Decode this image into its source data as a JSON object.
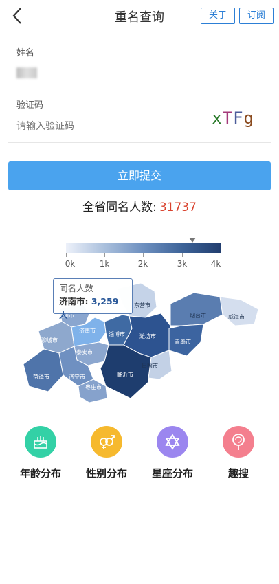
{
  "header": {
    "title": "重名查询",
    "about_label": "关于",
    "subscribe_label": "订阅"
  },
  "form": {
    "name_label": "姓名",
    "captcha_label": "验证码",
    "captcha_placeholder": "请输入验证码",
    "captcha_chars": [
      "x",
      "T",
      "F",
      "g"
    ]
  },
  "submit_label": "立即提交",
  "result": {
    "label": "全省同名人数:",
    "count": "31737"
  },
  "legend": {
    "ticks": [
      "0k",
      "1k",
      "2k",
      "3k",
      "4k"
    ],
    "marker_value": 3259
  },
  "tooltip": {
    "title": "同名人数",
    "city": "济南市:",
    "value": "3,259人"
  },
  "map": {
    "cities": [
      "德州市",
      "东营市",
      "烟台市",
      "威海市",
      "济南市",
      "淄博市",
      "潍坊市",
      "青岛市",
      "聊城市",
      "泰安市",
      "菏泽市",
      "济宁市",
      "临沂市",
      "日照市",
      "枣庄市"
    ]
  },
  "shortcuts": [
    {
      "label": "年龄分布",
      "icon": "cake-icon",
      "color": "#33d1a6"
    },
    {
      "label": "性别分布",
      "icon": "gender-icon",
      "color": "#f6b92e"
    },
    {
      "label": "星座分布",
      "icon": "star-of-david-icon",
      "color": "#9b86ef"
    },
    {
      "label": "趣搜",
      "icon": "lollipop-icon",
      "color": "#f47f8e"
    }
  ]
}
